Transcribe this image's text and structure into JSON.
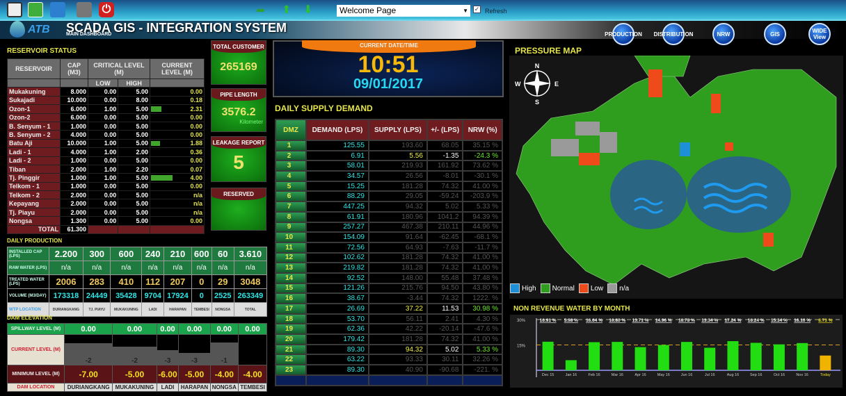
{
  "toolbar": {
    "icons": [
      "monitor-icon",
      "spreadsheet-icon",
      "clipboard-icon",
      "printer-icon",
      "power-icon"
    ],
    "page_select": "Welcome Page",
    "refresh_label": "Refresh",
    "refresh_checked": true
  },
  "header": {
    "logo": "ATB",
    "title": "SCADA GIS - INTEGRATION SYSTEM",
    "subtitle": "MAIN DASHBOARD",
    "nav": [
      {
        "label": "PRODUCTION"
      },
      {
        "label": "DISTRIBUTION"
      },
      {
        "label": "NRW"
      },
      {
        "label": "GIS"
      },
      {
        "label": "WIDE View"
      }
    ]
  },
  "reservoir": {
    "title": "RESERVOIR STATUS",
    "headers": {
      "reservoir": "RESERVOIR",
      "cap": "CAP (M3)",
      "critical": "CRITICAL LEVEL (M)",
      "low": "LOW",
      "high": "HIGH",
      "current": "CURRENT LEVEL (M)"
    },
    "rows": [
      {
        "name": "Mukakuning",
        "cap": "8.000",
        "low": "0.00",
        "high": "5.00",
        "current": "0.00",
        "fill": 0
      },
      {
        "name": "Sukajadi",
        "cap": "10.000",
        "low": "0.00",
        "high": "8.00",
        "current": "0.18",
        "fill": 0
      },
      {
        "name": "Ozon-1",
        "cap": "6.000",
        "low": "1.00",
        "high": "5.00",
        "current": "2.31",
        "fill": 0.2
      },
      {
        "name": "Ozon-2",
        "cap": "6.000",
        "low": "0.00",
        "high": "5.00",
        "current": "0.00",
        "fill": 0
      },
      {
        "name": "B. Senyum - 1",
        "cap": "1.000",
        "low": "0.00",
        "high": "5.00",
        "current": "0.00",
        "fill": 0
      },
      {
        "name": "B. Senyum - 2",
        "cap": "4.000",
        "low": "0.00",
        "high": "5.00",
        "current": "0.00",
        "fill": 0
      },
      {
        "name": "Batu Aji",
        "cap": "10.000",
        "low": "1.00",
        "high": "5.00",
        "current": "1.88",
        "fill": 0.17
      },
      {
        "name": "Ladi - 1",
        "cap": "4.000",
        "low": "1.00",
        "high": "2.00",
        "current": "0.36",
        "fill": 0
      },
      {
        "name": "Ladi - 2",
        "cap": "1.000",
        "low": "0.00",
        "high": "5.00",
        "current": "0.00",
        "fill": 0
      },
      {
        "name": "Tiban",
        "cap": "2.000",
        "low": "1.00",
        "high": "2.20",
        "current": "0.07",
        "fill": 0
      },
      {
        "name": "Tj. Pinggir",
        "cap": "1.000",
        "low": "1.00",
        "high": "5.00",
        "current": "4.00",
        "fill": 0.4
      },
      {
        "name": "Telkom - 1",
        "cap": "1.000",
        "low": "0.00",
        "high": "5.00",
        "current": "0.00",
        "fill": 0
      },
      {
        "name": "Telkom - 2",
        "cap": "2.000",
        "low": "0.00",
        "high": "5.00",
        "current": "n/a",
        "fill": 0
      },
      {
        "name": "Kepayang",
        "cap": "2.000",
        "low": "0.00",
        "high": "5.00",
        "current": "n/a",
        "fill": 0
      },
      {
        "name": "Tj. Piayu",
        "cap": "2.000",
        "low": "0.00",
        "high": "5.00",
        "current": "n/a",
        "fill": 0
      },
      {
        "name": "Nongsa",
        "cap": "1.300",
        "low": "0.00",
        "high": "5.00",
        "current": "0.00",
        "fill": 0
      }
    ],
    "total_label": "TOTAL",
    "total": "61.300"
  },
  "kpis": {
    "total_customer_label": "TOTAL CUSTOMER",
    "total_customer": "265169",
    "pipe_length_label": "PIPE LENGTH",
    "pipe_length": "3576.2",
    "pipe_unit": "Kilometer",
    "leakage_label": "LEAKAGE REPORT",
    "leakage": "5",
    "reserved_label": "RESERVED"
  },
  "clock": {
    "label": "CURRENT DATE/TIME",
    "time": "10:51",
    "date": "09/01/2017"
  },
  "supply": {
    "title": "DAILY SUPPLY DEMAND",
    "headers": [
      "DMZ",
      "DEMAND (LPS)",
      "SUPPLY (LPS)",
      "+/- (LPS)",
      "NRW (%)"
    ],
    "rows": [
      [
        "1",
        "125.55",
        "193.60",
        "68.05",
        "35.15 %",
        false
      ],
      [
        "2",
        "6.91",
        "5.56",
        "-1.35",
        "-24.3 %",
        true
      ],
      [
        "3",
        "58.01",
        "219.93",
        "161.92",
        "73.62 %",
        false
      ],
      [
        "4",
        "34.57",
        "26.56",
        "-8.01",
        "-30.1 %",
        false
      ],
      [
        "5",
        "15.25",
        "181.28",
        "74.32",
        "41.00 %",
        false
      ],
      [
        "6",
        "88.29",
        "29.05",
        "-59.24",
        "-203.9 %",
        false
      ],
      [
        "7",
        "447.25",
        "94.32",
        "5.02",
        "5.33 %",
        false
      ],
      [
        "8",
        "61.91",
        "180.96",
        "1041.2",
        "94.39 %",
        false
      ],
      [
        "9",
        "257.27",
        "467.38",
        "210.11",
        "44.96 %",
        false
      ],
      [
        "10",
        "154.09",
        "91.64",
        "-62.45",
        "-68.1 %",
        false
      ],
      [
        "11",
        "72.56",
        "64.93",
        "-7.63",
        "-11.7 %",
        false
      ],
      [
        "12",
        "102.62",
        "181.28",
        "74.32",
        "41.00 %",
        false
      ],
      [
        "13",
        "219.82",
        "181.28",
        "74.32",
        "41.00 %",
        false
      ],
      [
        "14",
        "92.52",
        "148.00",
        "55.48",
        "37.48 %",
        false
      ],
      [
        "15",
        "121.26",
        "215.76",
        "94.50",
        "43.80 %",
        false
      ],
      [
        "16",
        "38.67",
        "-3.44",
        "74.32",
        "1222. %",
        false
      ],
      [
        "17",
        "26.69",
        "37.22",
        "11.53",
        "30.98 %",
        true
      ],
      [
        "18",
        "53.70",
        "56.11",
        "2.41",
        "4.30 %",
        false
      ],
      [
        "19",
        "62.36",
        "42.22",
        "-20.14",
        "-47.6 %",
        false
      ],
      [
        "20",
        "179.42",
        "181.28",
        "74.32",
        "41.00 %",
        false
      ],
      [
        "21",
        "89.30",
        "94.32",
        "5.02",
        "5.33 %",
        true
      ],
      [
        "22",
        "63.22",
        "93.33",
        "30.11",
        "32.26 %",
        false
      ],
      [
        "23",
        "89.30",
        "40.90",
        "-90.68",
        "-221. %",
        false
      ]
    ]
  },
  "production": {
    "title": "DAILY PRODUCTION",
    "labels": [
      "INSTALLED CAP (LPS)",
      "RAW WATER (LPS)",
      "TREATED WATER (LPS)",
      "VOLUME (M3/DAY)",
      "WTP LOCATION"
    ],
    "installed": [
      "2.200",
      "300",
      "600",
      "240",
      "210",
      "600",
      "60",
      "3.610"
    ],
    "raw": [
      "n/a",
      "n/a",
      "n/a",
      "n/a",
      "n/a",
      "n/a",
      "n/a",
      "n/a"
    ],
    "treated": [
      "2006",
      "283",
      "410",
      "112",
      "207",
      "0",
      "29",
      "3048"
    ],
    "volume": [
      "173318",
      "24449",
      "35428",
      "9704",
      "17924",
      "0",
      "2525",
      "263349"
    ],
    "locations": [
      "DURIANGKANG",
      "TJ. PIAYU",
      "MUKAKUNING",
      "LADI",
      "HARAPAN",
      "TEMBESI",
      "NONGSA",
      "TOTAL"
    ]
  },
  "dam": {
    "title": "DAM ELEVATION",
    "labels": [
      "SPILLWAY LEVEL (M)",
      "CURRENT LEVEL (M)",
      "MINIMUM LEVEL (M)",
      "DAM LOCATION"
    ],
    "spillway": [
      "0.00",
      "0.00",
      "0.00",
      "0.00",
      "0.00",
      "0.00"
    ],
    "current": [
      "-2",
      "-2",
      "-3",
      "-3",
      "-1",
      ""
    ],
    "minimum": [
      "-7.00",
      "-5.00",
      "-6.00",
      "-5.00",
      "-4.00",
      "-4.00"
    ],
    "locations": [
      "DURIANGKANG",
      "MUKAKUNING",
      "LADI",
      "HARAPAN",
      "NONGSA",
      "TEMBESI"
    ]
  },
  "map": {
    "title": "PRESSURE MAP",
    "legend": [
      {
        "label": "High",
        "color": "#1e90d8"
      },
      {
        "label": "Normal",
        "color": "#2f9e1f"
      },
      {
        "label": "Low",
        "color": "#ee4a1a"
      },
      {
        "label": "n/a",
        "color": "#9a9a9a"
      }
    ],
    "compass": [
      "N",
      "E",
      "S",
      "W"
    ]
  },
  "chart_data": {
    "type": "bar",
    "title": "NON REVENUE WATER BY MONTH",
    "ylim": [
      0,
      30
    ],
    "yticks": [
      "30%",
      "15%"
    ],
    "target_line": 15,
    "categories": [
      "Dec 15",
      "Jan 16",
      "Feb 16",
      "Mar 16",
      "Apr 16",
      "May 16",
      "Jun 16",
      "Jul 16",
      "Aug 16",
      "Sep 16",
      "Oct 16",
      "Nov 16",
      "Today"
    ],
    "values": [
      16.91,
      5.98,
      16.64,
      16.8,
      13.71,
      14.96,
      16.78,
      13.34,
      17.24,
      16.24,
      15.34,
      16.1,
      8.73
    ],
    "labels": [
      "16.91 %",
      "5.98 %",
      "16.64 %",
      "16.80 %",
      "13.71 %",
      "14.96 %",
      "16.78 %",
      "13.34 %",
      "17.24 %",
      "16.24 %",
      "15.34 %",
      "16.10 %",
      "8.73 %"
    ],
    "colors": {
      "normal": "#22dd11",
      "current": "#f0b400"
    }
  }
}
